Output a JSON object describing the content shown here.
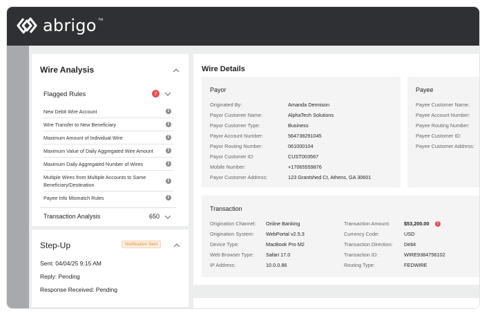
{
  "brand": {
    "name": "abrigo"
  },
  "wire_analysis": {
    "title": "Wire Analysis",
    "flagged_rules": {
      "label": "Flagged Rules",
      "count": "7",
      "items": [
        "New Debit Wire Account",
        "Wire Transfer to New Beneficiary",
        "Maximum Amount of Individual Wire",
        "Maximum Value of Daily Aggregated Wire Amount",
        "Maximum Daily Aggregated Number of Wires",
        "Multiple Wires from Multiple Accounts to Same Beneficiary/Destination",
        "Payee Info Mismatch Rules"
      ]
    },
    "transaction_analysis": {
      "label": "Transaction Analysis",
      "count": "650"
    }
  },
  "step_up": {
    "title": "Step-Up",
    "status": "Notification Sent",
    "sent": "Sent: 04/04/25 9:15 AM",
    "reply": "Reply: Pending",
    "response": "Response Received: Pending"
  },
  "wire_details": {
    "title": "Wire Details",
    "payor": {
      "title": "Payor",
      "rows": [
        {
          "k": "Originated By:",
          "v": "Amanda Dennison"
        },
        {
          "k": "Payor Customer Name:",
          "v": "AlphaTech Solutions"
        },
        {
          "k": "Payor Customer Type:",
          "v": "Business"
        },
        {
          "k": "Payor Account Number:",
          "v": "564738291045"
        },
        {
          "k": "Payor Routing Number:",
          "v": "061000104"
        },
        {
          "k": "Payor Customer ID:",
          "v": "CUST003567"
        },
        {
          "k": "Mobile Number:",
          "v": "+17065559876"
        },
        {
          "k": "Payor Customer Address:",
          "v": "123 Grantshed Ct, Athens, GA 30601"
        }
      ]
    },
    "payee": {
      "title": "Payee",
      "rows": [
        {
          "k": "Payee Customer Name:"
        },
        {
          "k": "Payee Account Number:"
        },
        {
          "k": "Payee Routing Number:"
        },
        {
          "k": "Payee Customer ID:"
        },
        {
          "k": "Payee Customer Address:"
        }
      ]
    },
    "transaction": {
      "title": "Transaction",
      "left": [
        {
          "k": "Origination Channel:",
          "v": "Online Banking"
        },
        {
          "k": "Origination System:",
          "v": "WebPortal v2.5.3"
        },
        {
          "k": "Device Type:",
          "v": "MacBook Pro M2"
        },
        {
          "k": "Web Browser Type:",
          "v": "Safari 17.0"
        },
        {
          "k": "IP Address:",
          "v": "10.0.0.86"
        }
      ],
      "right": [
        {
          "k": "Transaction Amount:",
          "v": "$53,200.00"
        },
        {
          "k": "Currency Code:",
          "v": "USD"
        },
        {
          "k": "Transaction Direction:",
          "v": "Debit"
        },
        {
          "k": "Transaction ID:",
          "v": "WIRE9384756102"
        },
        {
          "k": "Routing Type:",
          "v": "FEDWIRE"
        }
      ]
    }
  },
  "colors": {
    "topbar": "#2f3033",
    "alert": "#e2504f",
    "notification": "#e08a2e"
  }
}
